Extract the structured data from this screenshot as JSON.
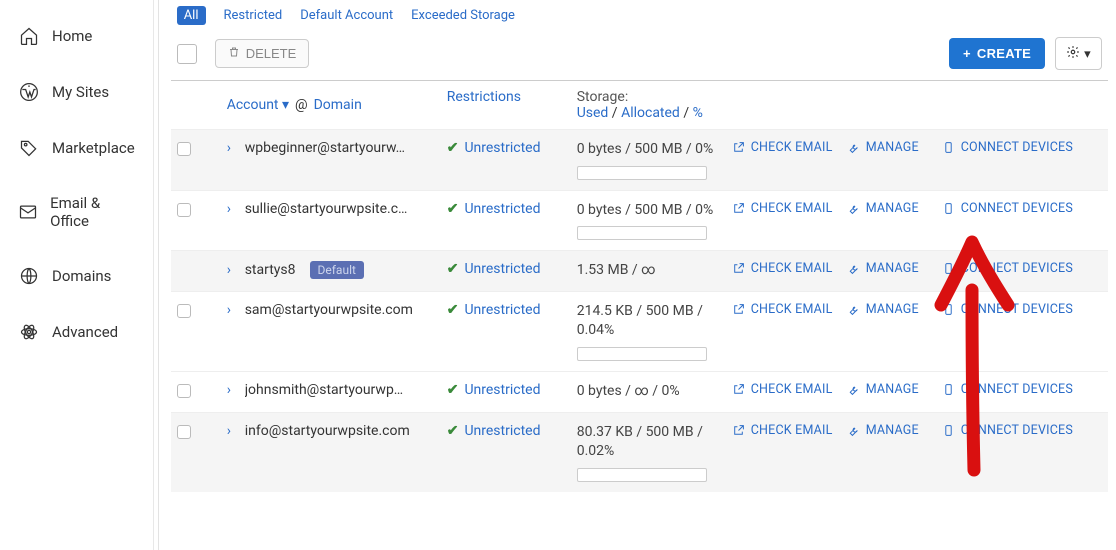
{
  "sidebar": {
    "items": [
      {
        "label": "Home"
      },
      {
        "label": "My Sites"
      },
      {
        "label": "Marketplace"
      },
      {
        "label": "Email & Office"
      },
      {
        "label": "Domains"
      },
      {
        "label": "Advanced"
      }
    ]
  },
  "tabs": {
    "all": "All",
    "restricted": "Restricted",
    "default_account": "Default Account",
    "exceeded_storage": "Exceeded Storage"
  },
  "toolbar": {
    "delete_label": "DELETE",
    "create_label": "CREATE"
  },
  "header": {
    "account": "Account",
    "at": "@",
    "domain": "Domain",
    "restrictions": "Restrictions",
    "storage_label": "Storage:",
    "used": "Used",
    "slash": " / ",
    "allocated": "Allocated",
    "percent": "%"
  },
  "action_labels": {
    "check_email": "CHECK EMAIL",
    "manage": "MANAGE",
    "connect_devices": "CONNECT DEVICES"
  },
  "restriction_label": "Unrestricted",
  "default_badge": "Default",
  "rows": [
    {
      "account": "wpbeginner@startyourw…",
      "storage": "0 bytes / 500 MB / 0%",
      "bar": true,
      "badge": false
    },
    {
      "account": "sullie@startyourwpsite.c…",
      "storage": "0 bytes / 500 MB / 0%",
      "bar": true,
      "badge": false
    },
    {
      "account": "startys8",
      "storage": "1.53 MB / ∞",
      "bar": false,
      "badge": true
    },
    {
      "account": "sam@startyourwpsite.com",
      "storage": "214.5 KB / 500 MB / 0.04%",
      "bar": true,
      "badge": false
    },
    {
      "account": "johnsmith@startyourwp…",
      "storage": "0 bytes / ∞ / 0%",
      "bar": false,
      "badge": false
    },
    {
      "account": "info@startyourwpsite.com",
      "storage": "80.37 KB / 500 MB / 0.02%",
      "bar": true,
      "badge": false
    }
  ]
}
